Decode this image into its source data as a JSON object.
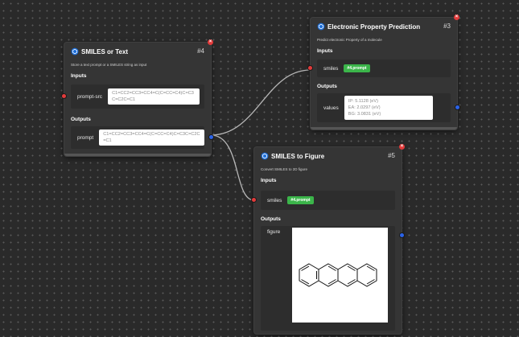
{
  "nodes": {
    "smiles_text": {
      "title": "SMILES or Text",
      "id": "#4",
      "description": "Store a text prompt or a SMILES string as input",
      "inputs_label": "Inputs",
      "input_port_label": "prompt-src",
      "input_value": "C1=CC2=CC3=CC4=C(C=CC=C4)C=C3C=C2C=C1",
      "outputs_label": "Outputs",
      "output_port_label": "prompt",
      "output_value": "C1=CC2=CC3=CC4=C(C=CC=C4)C=C3C=C2C=C1"
    },
    "electronic": {
      "title": "Electronic Property Prediction",
      "id": "#3",
      "description": "Predict electronic Property of a molecule",
      "inputs_label": "Inputs",
      "input_port_label": "smiles",
      "input_badge": "#4.prompt",
      "outputs_label": "Outputs",
      "output_port_label": "values",
      "output_lines": [
        "IP: 5.1128 (eV)",
        "EA: 2.0297 (eV)",
        "BG: 3.0831 (eV)"
      ]
    },
    "figure": {
      "title": "SMILES to Figure",
      "id": "#5",
      "description": "Convert SMILES to 2D figure",
      "inputs_label": "Inputs",
      "input_port_label": "smiles",
      "input_badge": "#4.prompt",
      "outputs_label": "Outputs",
      "output_port_label": "figure"
    }
  },
  "colors": {
    "input_port": "#e23b3b",
    "output_port": "#2b63e8",
    "badge": "#3bb54a",
    "close": "#e23b3b"
  }
}
